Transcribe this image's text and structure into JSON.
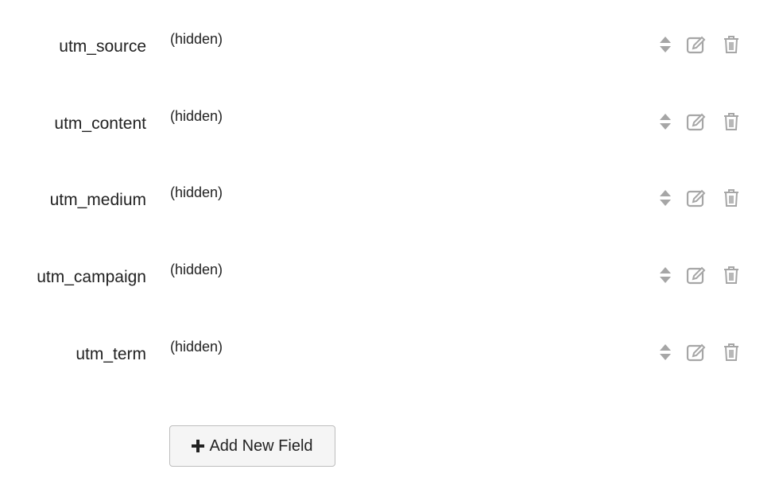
{
  "fields": [
    {
      "label": "utm_source",
      "value": "(hidden)"
    },
    {
      "label": "utm_content",
      "value": "(hidden)"
    },
    {
      "label": "utm_medium",
      "value": "(hidden)"
    },
    {
      "label": "utm_campaign",
      "value": "(hidden)"
    },
    {
      "label": "utm_term",
      "value": "(hidden)"
    }
  ],
  "row_actions": {
    "icons": [
      "sort-icon",
      "edit-icon",
      "trash-icon"
    ],
    "icon_color": "#a6a6a6"
  },
  "add_field": {
    "icon": "plus-icon",
    "label": "Add New Field"
  }
}
